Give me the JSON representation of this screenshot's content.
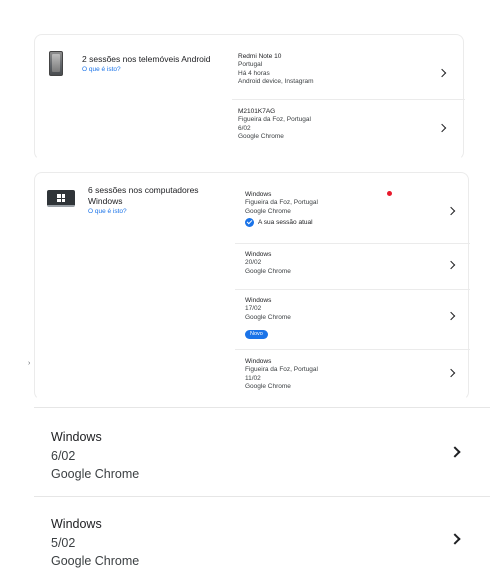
{
  "android_group": {
    "title": "2 sessões nos telemóveis Android",
    "help_link": "O que é isto?",
    "icon": "phone-icon",
    "sessions": [
      {
        "device": "Redmi Note 10",
        "details": [
          "Portugal",
          "Há 4 horas",
          "Android device, Instagram"
        ]
      },
      {
        "device": "M2101K7AG",
        "details": [
          "Figueira da Foz, Portugal",
          "6/02",
          "Google Chrome"
        ]
      }
    ]
  },
  "windows_group": {
    "title_line1": "6 sessões nos computadores",
    "title_line2": "Windows",
    "help_link": "O que é isto?",
    "icon": "laptop-windows-icon",
    "current_session_label": "A sua sessão atual",
    "new_badge": "Novo",
    "sessions": [
      {
        "device": "Windows",
        "details": [
          "Figueira da Foz, Portugal",
          "Google Chrome"
        ],
        "current": true
      },
      {
        "device": "Windows",
        "details": [
          "20/02",
          "Google Chrome"
        ]
      },
      {
        "device": "Windows",
        "details": [
          "17/02",
          "Google Chrome"
        ],
        "new": true
      },
      {
        "device": "Windows",
        "details": [
          "Figueira da Foz, Portugal",
          "11/02",
          "Google Chrome"
        ]
      }
    ]
  },
  "zoomed_sessions": [
    {
      "device": "Windows",
      "details": [
        "6/02",
        "Google Chrome"
      ]
    },
    {
      "device": "Windows",
      "details": [
        "5/02",
        "Google Chrome"
      ]
    }
  ],
  "side_arrow": "›",
  "colors": {
    "link": "#1a73e8",
    "badge": "#1a73e8",
    "notification_dot": "#e8192c",
    "text": "#202124",
    "divider": "#ebebeb"
  }
}
